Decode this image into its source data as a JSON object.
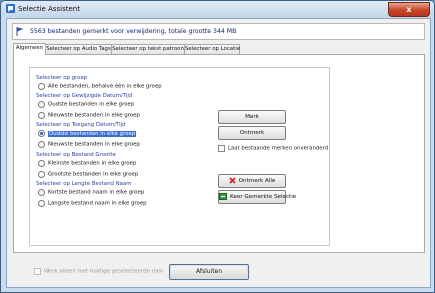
{
  "window": {
    "title": "Selectie Assistent",
    "close_label": "x"
  },
  "header": {
    "summary": "5563 bestanden gemerkt voor verwijdering, totale grootte 344 MB"
  },
  "tabs": [
    {
      "label": "Algemeen",
      "active": true
    },
    {
      "label": "Selecteer op Audio Tags",
      "active": false
    },
    {
      "label": "Selecteer op tekst patroon",
      "active": false
    },
    {
      "label": "Selecteer op Locatie",
      "active": false
    }
  ],
  "sections": {
    "group": {
      "heading": "Selecteer op groep",
      "options": [
        {
          "label": "Alle bestanden, behalve één in elke groep",
          "checked": false
        }
      ]
    },
    "modified": {
      "heading": "Selecteer op Gewijzigde Datum/Tijd",
      "options": [
        {
          "label": "Oudste bestanden in elke groep",
          "checked": false
        },
        {
          "label": "Nieuwste bestanden in elke groep",
          "checked": false
        }
      ]
    },
    "accessed": {
      "heading": "Selecteer op Toegang Datum/Tijd",
      "options": [
        {
          "label": "Oudste bestanden in elke groep",
          "checked": true
        },
        {
          "label": "Nieuwste bestanden in elke groep",
          "checked": false
        }
      ]
    },
    "size": {
      "heading": "Selecteer op Bestand Grootte",
      "options": [
        {
          "label": "Kleinste bestanden in elke groep",
          "checked": false
        },
        {
          "label": "Grootste bestanden in elke groep",
          "checked": false
        }
      ]
    },
    "name_length": {
      "heading": "Selecteer op Lengte Bestand Naam",
      "options": [
        {
          "label": "Kortste bestand naam in elke groep",
          "checked": false
        },
        {
          "label": "Langste bestand naam in elke groep",
          "checked": false
        }
      ]
    }
  },
  "actions": {
    "mark": "Merk",
    "unmark": "Ontmerk",
    "leave_marked": "Laat bestaande merken onveranderd",
    "unmark_all": "Ontmerk Alle",
    "keep_selection": "Keer Gemerkte Selectie"
  },
  "footer": {
    "skip_current": "Werk alleen met huidige geselecteerde rijen",
    "close_button": "Afsluiten"
  },
  "colors": {
    "accent": "#2b3fa0",
    "highlight": "#3b6fcf"
  }
}
